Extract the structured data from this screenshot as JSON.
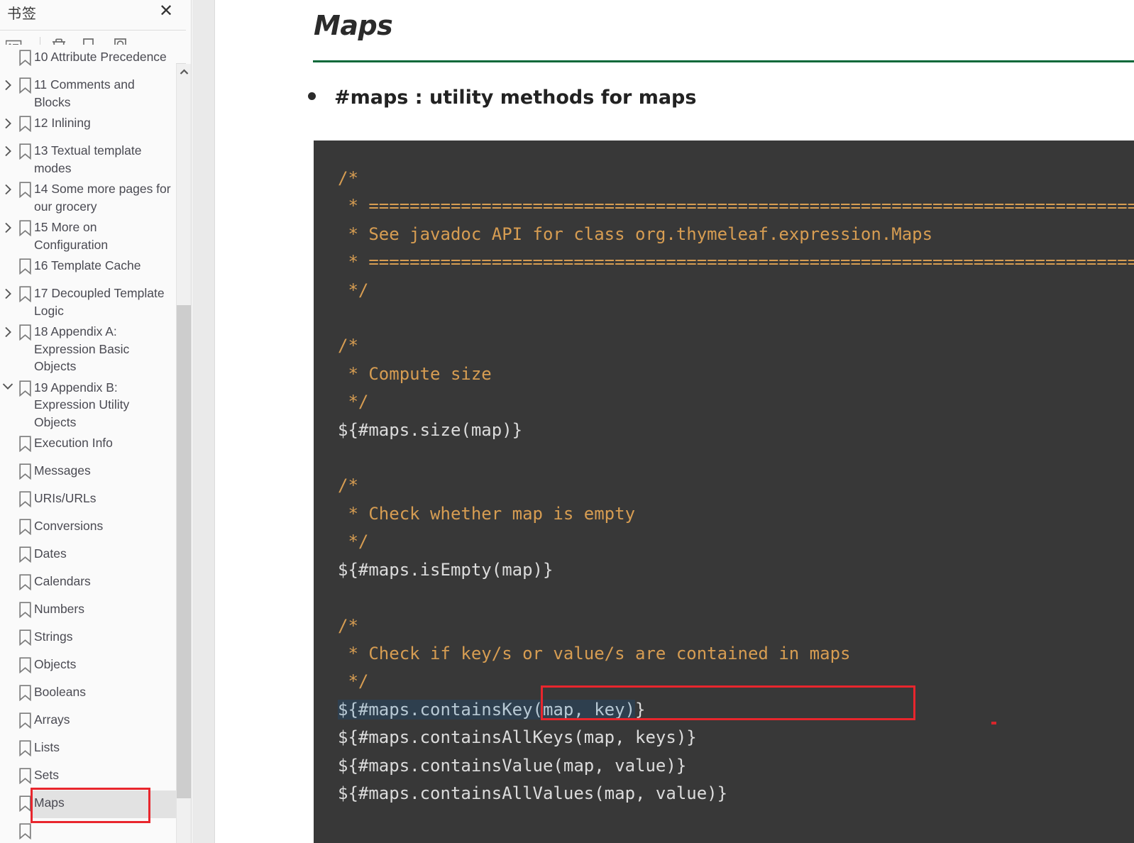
{
  "sidebar": {
    "panel_title": "书签",
    "close_label": "✕",
    "toolbar": [
      {
        "name": "list-options-icon",
        "label": "List options"
      },
      {
        "name": "delete-icon",
        "label": "Delete"
      },
      {
        "name": "add-bookmark-icon",
        "label": "Add bookmark"
      },
      {
        "name": "locate-bookmark-icon",
        "label": "Locate bookmark"
      }
    ],
    "items": [
      {
        "label": "10 Attribute Precedence",
        "level": 1,
        "chevron": "none",
        "selected": false,
        "clipped": true
      },
      {
        "label": "11 Comments and Blocks",
        "level": 1,
        "chevron": "right",
        "selected": false
      },
      {
        "label": "12 Inlining",
        "level": 1,
        "chevron": "right",
        "selected": false
      },
      {
        "label": "13 Textual template modes",
        "level": 1,
        "chevron": "right",
        "selected": false
      },
      {
        "label": "14 Some more pages for our grocery",
        "level": 1,
        "chevron": "right",
        "selected": false
      },
      {
        "label": "15 More on Configuration",
        "level": 1,
        "chevron": "right",
        "selected": false
      },
      {
        "label": "16 Template Cache",
        "level": 1,
        "chevron": "none",
        "selected": false
      },
      {
        "label": "17 Decoupled Template Logic",
        "level": 1,
        "chevron": "right",
        "selected": false
      },
      {
        "label": "18 Appendix A: Expression Basic Objects",
        "level": 1,
        "chevron": "right",
        "selected": false
      },
      {
        "label": "19 Appendix B: Expression Utility Objects",
        "level": 1,
        "chevron": "down",
        "selected": false
      },
      {
        "label": "Execution Info",
        "level": 2,
        "chevron": "none",
        "selected": false
      },
      {
        "label": "Messages",
        "level": 2,
        "chevron": "none",
        "selected": false
      },
      {
        "label": "URIs/URLs",
        "level": 2,
        "chevron": "none",
        "selected": false
      },
      {
        "label": "Conversions",
        "level": 2,
        "chevron": "none",
        "selected": false
      },
      {
        "label": "Dates",
        "level": 2,
        "chevron": "none",
        "selected": false
      },
      {
        "label": "Calendars",
        "level": 2,
        "chevron": "none",
        "selected": false
      },
      {
        "label": "Numbers",
        "level": 2,
        "chevron": "none",
        "selected": false
      },
      {
        "label": "Strings",
        "level": 2,
        "chevron": "none",
        "selected": false
      },
      {
        "label": "Objects",
        "level": 2,
        "chevron": "none",
        "selected": false
      },
      {
        "label": "Booleans",
        "level": 2,
        "chevron": "none",
        "selected": false
      },
      {
        "label": "Arrays",
        "level": 2,
        "chevron": "none",
        "selected": false
      },
      {
        "label": "Lists",
        "level": 2,
        "chevron": "none",
        "selected": false
      },
      {
        "label": "Sets",
        "level": 2,
        "chevron": "none",
        "selected": false
      },
      {
        "label": "Maps",
        "level": 2,
        "chevron": "none",
        "selected": true
      },
      {
        "label": "",
        "level": 2,
        "chevron": "none",
        "selected": false,
        "clipped": true
      }
    ]
  },
  "main": {
    "title": "Maps",
    "rule_color": "#056839",
    "bullet": "#maps : utility methods for maps",
    "code": {
      "background": "#383838",
      "comment_color": "#d79d52",
      "text_color": "#dcdcdc",
      "selection_background": "#2e3f4e",
      "selection_text": "#b8c9d4",
      "selected_text": "${#maps.containsKey(map, key)",
      "lines": [
        "/*",
        " * =================================================================================",
        " * See javadoc API for class org.thymeleaf.expression.Maps",
        " * =================================================================================",
        " */",
        "",
        "/*",
        " * Compute size",
        " */",
        "${#maps.size(map)}",
        "",
        "/*",
        " * Check whether map is empty",
        " */",
        "${#maps.isEmpty(map)}",
        "",
        "/*",
        " * Check if key/s or value/s are contained in maps",
        " */",
        "${#maps.containsKey(map, key)}",
        "${#maps.containsAllKeys(map, keys)}",
        "${#maps.containsValue(map, value)}",
        "${#maps.containsAllValues(map, value)}"
      ]
    }
  },
  "annotations": {
    "color": "#e8262d",
    "boxes": [
      "code-containsKey-line",
      "sidebar-maps-item"
    ]
  }
}
